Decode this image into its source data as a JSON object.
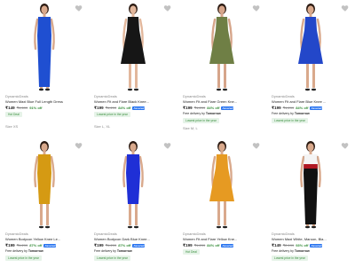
{
  "products": [
    {
      "brand": "DynamicDeals",
      "title": "Women Maxi Blue Full Length Dress",
      "price": "₹149",
      "mrp": "₹1,699",
      "off": "91% off",
      "assured": "",
      "delivery_prefix": "",
      "delivery_day": "",
      "lowest": "",
      "hot_deal": "Hot Deal",
      "size": "Size XS",
      "dress_color": "#1f4fd1",
      "skin_color": "#d9a98c",
      "hair_color": "#2a1a12"
    },
    {
      "brand": "DynamicDeals",
      "title": "Women Fit and Flare Black Knee...",
      "price": "₹199",
      "mrp": "₹1,299",
      "off": "84% off",
      "assured": "Assured",
      "delivery_prefix": "",
      "delivery_day": "",
      "lowest": "Lowest price in the year",
      "hot_deal": "",
      "size": "Size L, XL",
      "dress_color": "#161616",
      "skin_color": "#e2b79c",
      "hair_color": "#2a1a12"
    },
    {
      "brand": "DynamicDeals",
      "title": "Women Fit and Flare Green Kne...",
      "price": "₹199",
      "mrp": "₹1,299",
      "off": "84% off",
      "assured": "Assured",
      "delivery_prefix": "Free delivery by",
      "delivery_day": "Tomorrow",
      "lowest": "Lowest price in the year",
      "hot_deal": "",
      "size": "Size M, L",
      "dress_color": "#6f7f45",
      "skin_color": "#d6a58a",
      "hair_color": "#2a1a12"
    },
    {
      "brand": "DynamicDeals",
      "title": "Women Fit and Flare Blue Knee ...",
      "price": "₹199",
      "mrp": "₹1,299",
      "off": "84% off",
      "assured": "Assured",
      "delivery_prefix": "Free delivery by",
      "delivery_day": "Tomorrow",
      "lowest": "Lowest price in the year",
      "hot_deal": "",
      "size": "",
      "dress_color": "#2347c9",
      "skin_color": "#d9a98c",
      "hair_color": "#2a1a12"
    },
    {
      "brand": "DynamicDeals",
      "title": "Women Bodycon Yellow Knee Le...",
      "price": "₹199",
      "mrp": "₹1,299",
      "off": "87% off",
      "assured": "Assured",
      "delivery_prefix": "Free delivery by",
      "delivery_day": "Tomorrow",
      "lowest": "Lowest price in the year",
      "hot_deal": "",
      "size": "",
      "dress_color": "#d59a13",
      "skin_color": "#d9a98c",
      "hair_color": "#2a1a12"
    },
    {
      "brand": "DynamicDeals",
      "title": "Women Bodycon Dark Blue Knee...",
      "price": "₹199",
      "mrp": "₹1,299",
      "off": "87% off",
      "assured": "Assured",
      "delivery_prefix": "Free delivery by",
      "delivery_day": "Tomorrow",
      "lowest": "Lowest price in the year",
      "hot_deal": "",
      "size": "",
      "dress_color": "#1f2fd6",
      "skin_color": "#d9a98c",
      "hair_color": "#2a1a12"
    },
    {
      "brand": "DynamicDeals",
      "title": "Women Fit and Flare Yellow Kne...",
      "price": "₹199",
      "mrp": "₹1,299",
      "off": "84% off",
      "assured": "Assured",
      "delivery_prefix": "",
      "delivery_day": "",
      "lowest": "",
      "hot_deal": "Hot Deal",
      "size": "",
      "dress_color": "#e69a22",
      "skin_color": "#d9a98c",
      "hair_color": "#2a1a12"
    },
    {
      "brand": "DynamicDeals",
      "title": "Women Maxi White, Maroon, Bla...",
      "price": "₹149",
      "mrp": "₹2,199",
      "off": "93% off",
      "assured": "Assured",
      "delivery_prefix": "Free delivery by",
      "delivery_day": "Tomorrow",
      "lowest": "Lowest price in the year",
      "hot_deal": "",
      "size": "",
      "dress_color": "#111111",
      "dress_top_color": "#f4f4f4",
      "dress_band_color": "#b01822",
      "skin_color": "#d9a98c",
      "hair_color": "#2a1a12"
    }
  ],
  "icons": {
    "wishlist": "heart-icon"
  },
  "colors": {
    "price_off": "#388e3c",
    "assured_badge": "#2874f0",
    "muted": "#878787"
  }
}
